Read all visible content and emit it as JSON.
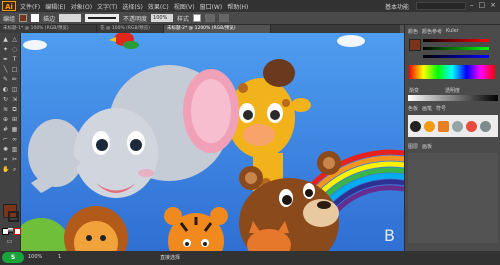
{
  "menubar": {
    "logo": "Ai",
    "items": [
      "文件(F)",
      "编辑(E)",
      "对象(O)",
      "文字(T)",
      "选择(S)",
      "效果(C)",
      "视图(V)",
      "窗口(W)",
      "帮助(H)"
    ],
    "workspace": "基本功能"
  },
  "controlbar": {
    "label_group": "编组",
    "stroke_label": "描边",
    "stroke_value": "",
    "opacity_label": "不透明度",
    "opacity_value": "100%",
    "style_label": "样式"
  },
  "tabs": [
    {
      "label": "未标题-1* @ 100% (RGB/预览)"
    },
    {
      "label": "花 @ 100% (RGB/预览)"
    },
    {
      "label": "未标题-2* @ 1200% (RGB/预览)"
    }
  ],
  "panel": {
    "color_tabs": [
      "颜色",
      "颜色参考",
      "Kuler"
    ],
    "swatch_tabs": [
      "色板",
      "画笔",
      "符号"
    ],
    "layers_tabs": [
      "图层",
      "画板"
    ],
    "section_labels": [
      "渐变",
      "透明度"
    ]
  },
  "status": {
    "zoom": "100%",
    "page": "1",
    "mode": "直接选择"
  },
  "colors": {
    "sky": "#3e88e6",
    "fill": "#7a3418",
    "accent": "#ff9a00"
  }
}
